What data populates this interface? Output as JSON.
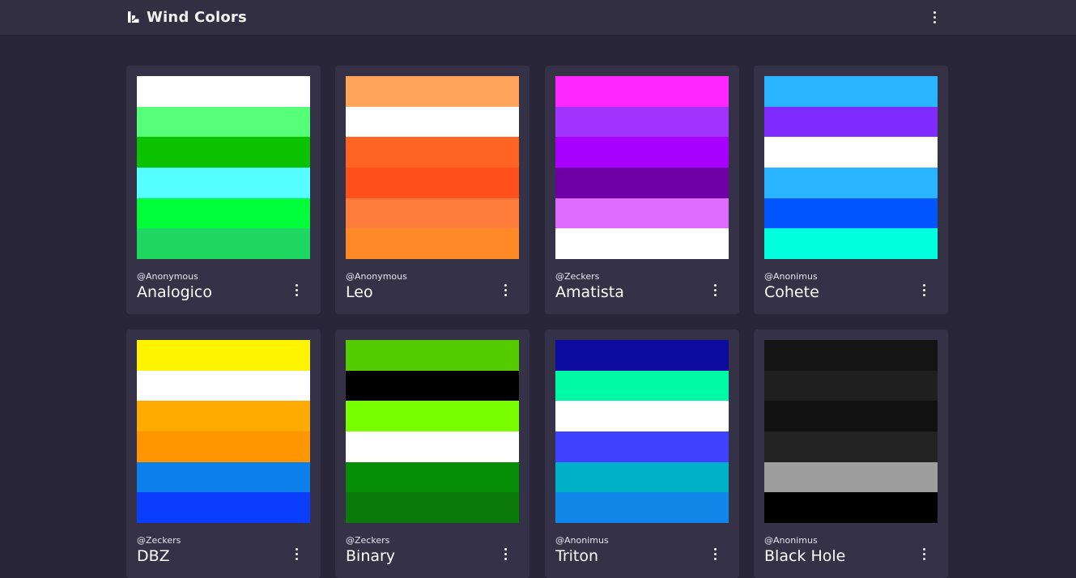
{
  "app": {
    "title": "Wind Colors",
    "logo_icon": "wind-colors-logo-icon",
    "menu_icon": "kebab-menu-icon"
  },
  "palettes": [
    {
      "author": "@Anonymous",
      "name": "Analogico",
      "colors": [
        "#ffffff",
        "#55ff77",
        "#0ac200",
        "#55ffff",
        "#00ff3b",
        "#1ed760"
      ]
    },
    {
      "author": "@Anonymous",
      "name": "Leo",
      "colors": [
        "#ffa45b",
        "#ffffff",
        "#ff6422",
        "#ff4f1a",
        "#ff7d3c",
        "#ff8827"
      ]
    },
    {
      "author": "@Zeckers",
      "name": "Amatista",
      "colors": [
        "#ff27ff",
        "#a033ff",
        "#a700ff",
        "#6f00a6",
        "#df6bff",
        "#ffffff"
      ]
    },
    {
      "author": "@Anonimus",
      "name": "Cohete",
      "colors": [
        "#2ab4ff",
        "#7f2aff",
        "#ffffff",
        "#2ab4ff",
        "#0055ff",
        "#00ffde"
      ]
    },
    {
      "author": "@Zeckers",
      "name": "DBZ",
      "colors": [
        "#fff400",
        "#ffffff",
        "#ffaa00",
        "#ff9500",
        "#0d7fea",
        "#0b3dff"
      ]
    },
    {
      "author": "@Zeckers",
      "name": "Binary",
      "colors": [
        "#55cc00",
        "#000000",
        "#77ff00",
        "#ffffff",
        "#068f06",
        "#0a7a0a"
      ]
    },
    {
      "author": "@Anonimus",
      "name": "Triton",
      "colors": [
        "#0c0ca0",
        "#00f9a4",
        "#ffffff",
        "#4040ff",
        "#00b0c8",
        "#0f86e8"
      ]
    },
    {
      "author": "@Anonimus",
      "name": "Black Hole",
      "colors": [
        "#141414",
        "#1f1f1f",
        "#111111",
        "#232323",
        "#9e9e9e",
        "#000000"
      ]
    }
  ]
}
